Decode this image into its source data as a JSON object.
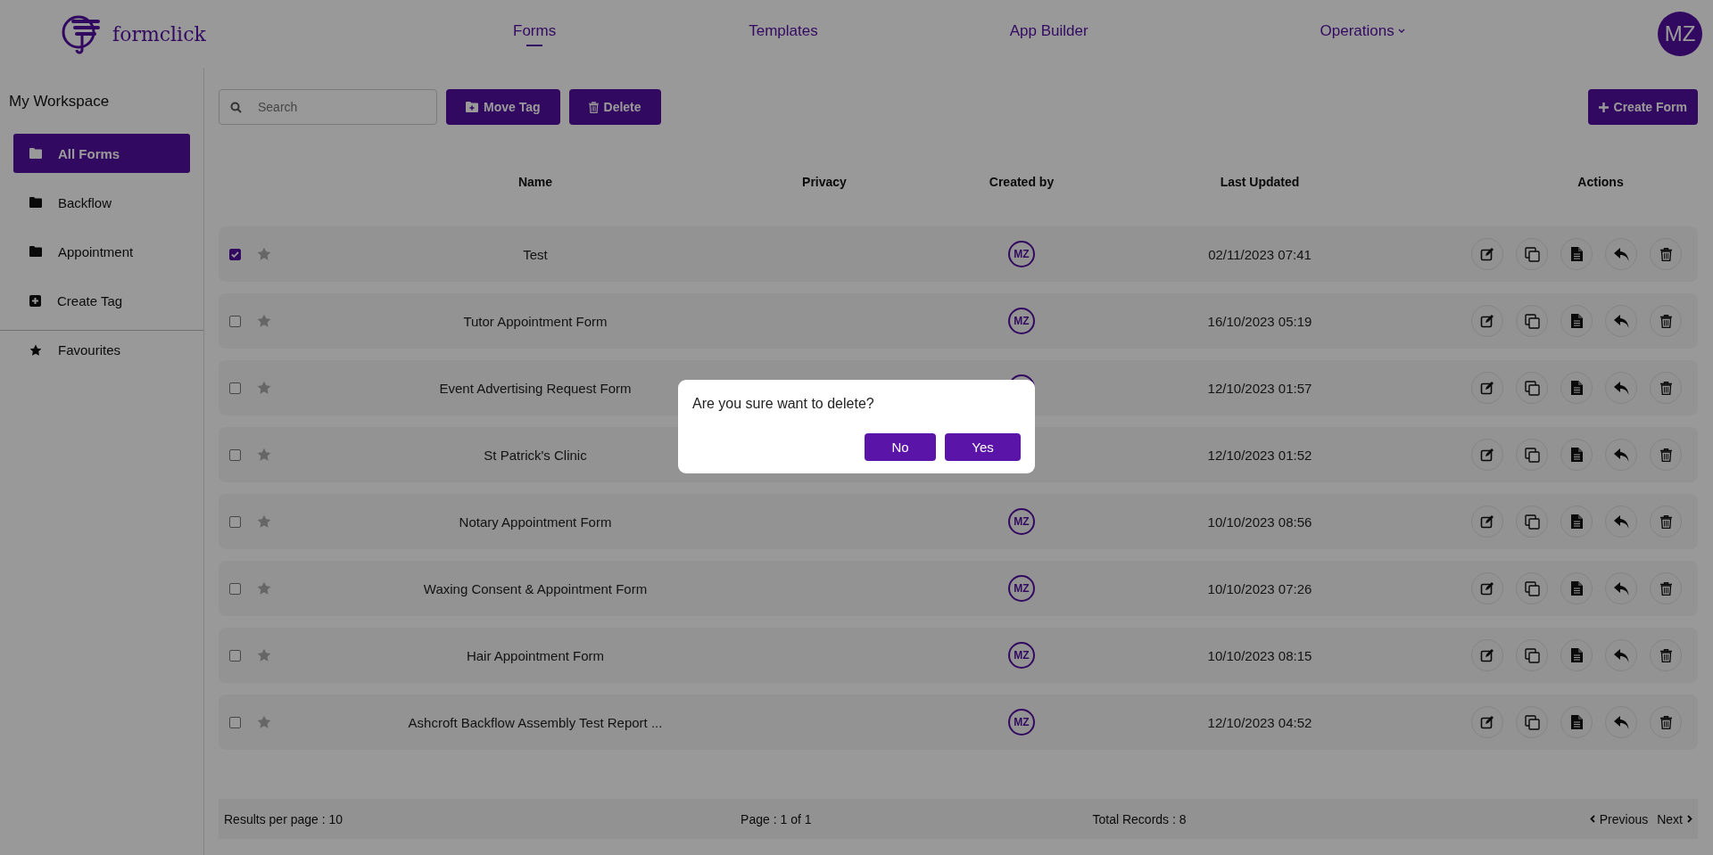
{
  "header": {
    "logo_text": "formclick",
    "nav": [
      {
        "label": "Forms",
        "selected": true,
        "kind": "link"
      },
      {
        "label": "Templates",
        "selected": false,
        "kind": "link"
      },
      {
        "label": "App Builder",
        "selected": false,
        "kind": "link"
      },
      {
        "label": "Operations",
        "selected": false,
        "kind": "dropdown"
      }
    ],
    "avatar": "MZ"
  },
  "sidebar": {
    "title": "My Workspace",
    "items": [
      {
        "label": "All Forms",
        "kind": "folder",
        "selected": true
      },
      {
        "label": "Backflow",
        "kind": "folder",
        "selected": false
      },
      {
        "label": "Appointment",
        "kind": "folder",
        "selected": false
      },
      {
        "label": "Create Tag",
        "kind": "add",
        "selected": false
      },
      {
        "label": "Favourites",
        "kind": "star",
        "selected": false
      }
    ]
  },
  "toolbar": {
    "search": {
      "placeholder": "Search"
    },
    "buttons": [
      {
        "label": "Move Tag",
        "kind": "move"
      },
      {
        "label": "Delete",
        "kind": "delete"
      }
    ],
    "create_button": "Create Form"
  },
  "table": {
    "columns": [
      "Name",
      "Privacy",
      "Created by",
      "Last Updated",
      "Actions"
    ],
    "rows": [
      {
        "name": "Test",
        "checked": true,
        "created_by": "MZ",
        "last_updated": "02/11/2023 07:41"
      },
      {
        "name": "Tutor Appointment Form",
        "checked": false,
        "created_by": "MZ",
        "last_updated": "16/10/2023 05:19"
      },
      {
        "name": "Event Advertising Request Form",
        "checked": false,
        "last_updated": "12/10/2023 01:57"
      },
      {
        "name": "St Patrick's Clinic",
        "checked": false,
        "last_updated": "12/10/2023 01:52"
      },
      {
        "name": "Notary Appointment Form",
        "checked": false,
        "created_by": "MZ",
        "last_updated": "10/10/2023 08:56"
      },
      {
        "name": "Waxing Consent & Appointment Form",
        "checked": false,
        "created_by": "MZ",
        "last_updated": "10/10/2023 07:26"
      },
      {
        "name": "Hair Appointment Form",
        "checked": false,
        "created_by": "MZ",
        "last_updated": "10/10/2023 08:15"
      },
      {
        "name": "Ashcroft Backflow Assembly Test Report ...",
        "checked": false,
        "created_by": "MZ",
        "last_updated": "12/10/2023 04:52"
      }
    ]
  },
  "footer": {
    "results_per_page": "Results per page : 10",
    "page": "Page : 1 of 1",
    "total": "Total Records : 8",
    "previous": "Previous",
    "next": "Next"
  },
  "dialog": {
    "message": "Are you sure want to delete?",
    "buttons": [
      "No",
      "Yes"
    ]
  }
}
